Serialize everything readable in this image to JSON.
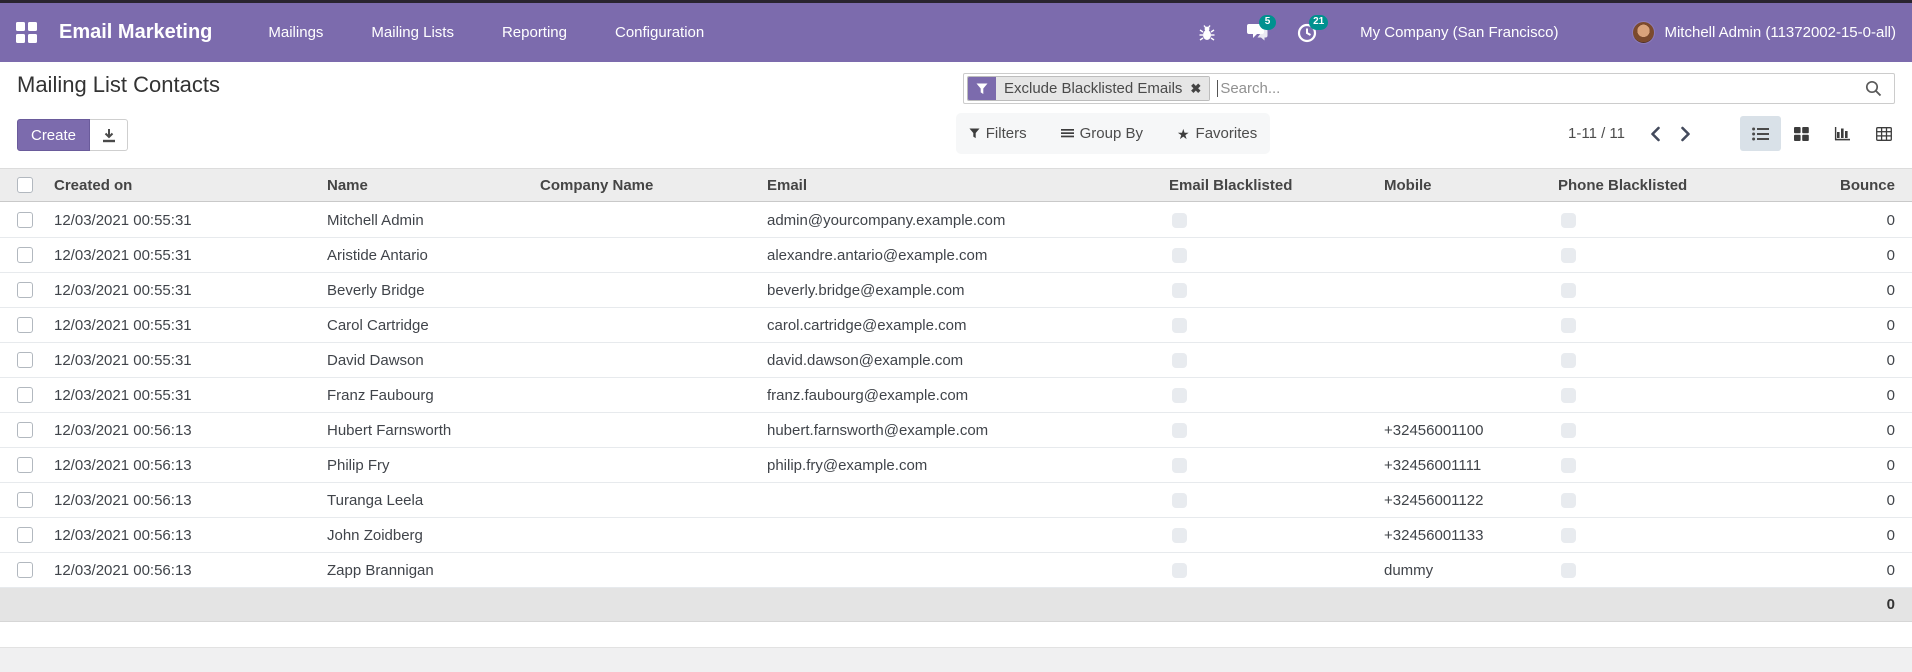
{
  "navbar": {
    "app_name": "Email Marketing",
    "menu_items": [
      "Mailings",
      "Mailing Lists",
      "Reporting",
      "Configuration"
    ],
    "messages_badge": "5",
    "activities_badge": "21",
    "company": "My Company (San Francisco)",
    "user": "Mitchell Admin (11372002-15-0-all)"
  },
  "control_panel": {
    "title": "Mailing List Contacts",
    "create_label": "Create",
    "filter_chip": "Exclude Blacklisted Emails",
    "filter_chip_remove": "✖",
    "search_placeholder": "Search...",
    "filters_label": "Filters",
    "group_by_label": "Group By",
    "favorites_label": "Favorites",
    "favorites_star": "★",
    "pager": "1-11 / 11",
    "view_switcher_icons": [
      "list-view-icon",
      "kanban-view-icon",
      "graph-view-icon",
      "pivot-view-icon"
    ],
    "active_view": "list"
  },
  "table": {
    "columns": [
      "Created on",
      "Name",
      "Company Name",
      "Email",
      "Email Blacklisted",
      "Mobile",
      "Phone Blacklisted",
      "Bounce"
    ],
    "rows": [
      {
        "created": "12/03/2021 00:55:31",
        "name": "Mitchell Admin",
        "company": "",
        "email": "admin@yourcompany.example.com",
        "mobile": "",
        "bounce": "0"
      },
      {
        "created": "12/03/2021 00:55:31",
        "name": "Aristide Antario",
        "company": "",
        "email": "alexandre.antario@example.com",
        "mobile": "",
        "bounce": "0"
      },
      {
        "created": "12/03/2021 00:55:31",
        "name": "Beverly Bridge",
        "company": "",
        "email": "beverly.bridge@example.com",
        "mobile": "",
        "bounce": "0"
      },
      {
        "created": "12/03/2021 00:55:31",
        "name": "Carol Cartridge",
        "company": "",
        "email": "carol.cartridge@example.com",
        "mobile": "",
        "bounce": "0"
      },
      {
        "created": "12/03/2021 00:55:31",
        "name": "David Dawson",
        "company": "",
        "email": "david.dawson@example.com",
        "mobile": "",
        "bounce": "0"
      },
      {
        "created": "12/03/2021 00:55:31",
        "name": "Franz Faubourg",
        "company": "",
        "email": "franz.faubourg@example.com",
        "mobile": "",
        "bounce": "0"
      },
      {
        "created": "12/03/2021 00:56:13",
        "name": "Hubert Farnsworth",
        "company": "",
        "email": "hubert.farnsworth@example.com",
        "mobile": "+32456001100",
        "bounce": "0"
      },
      {
        "created": "12/03/2021 00:56:13",
        "name": "Philip Fry",
        "company": "",
        "email": "philip.fry@example.com",
        "mobile": "+32456001111",
        "bounce": "0"
      },
      {
        "created": "12/03/2021 00:56:13",
        "name": "Turanga Leela",
        "company": "",
        "email": "",
        "mobile": "+32456001122",
        "bounce": "0"
      },
      {
        "created": "12/03/2021 00:56:13",
        "name": "John Zoidberg",
        "company": "",
        "email": "",
        "mobile": "+32456001133",
        "bounce": "0"
      },
      {
        "created": "12/03/2021 00:56:13",
        "name": "Zapp Brannigan",
        "company": "",
        "email": "",
        "mobile": "dummy",
        "bounce": "0"
      }
    ],
    "footer_bounce": "0"
  },
  "colors": {
    "navbar_bg": "#7c6bad",
    "badge_bg": "#00918f",
    "create_button_bg": "#7c6bad",
    "header_row_bg": "#ededed",
    "footer_row_bg": "#e4e4e4",
    "active_view_bg": "#d9e1e8"
  }
}
